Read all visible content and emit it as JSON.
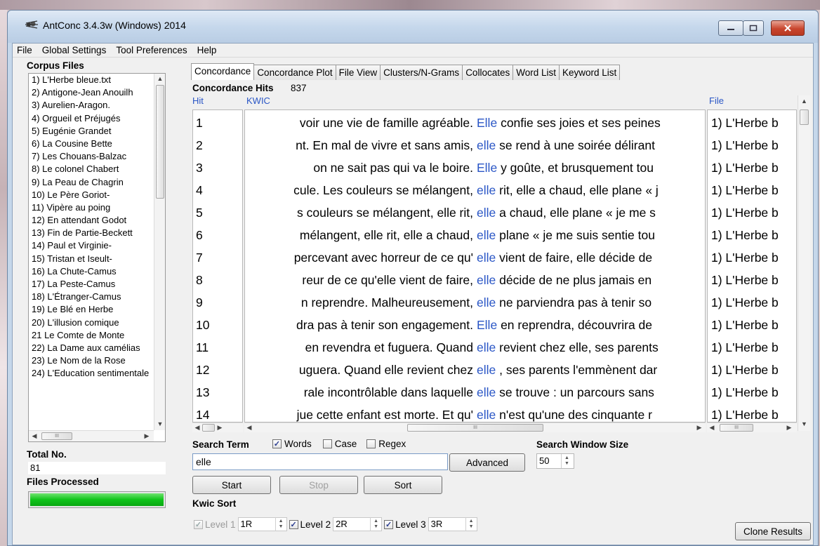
{
  "window": {
    "title": "AntConc 3.4.3w (Windows) 2014",
    "controls": {
      "minimize": "—",
      "maximize": "☐",
      "close": "✕"
    }
  },
  "menu": [
    "File",
    "Global Settings",
    "Tool Preferences",
    "Help"
  ],
  "left_panel": {
    "corpus_files_label": "Corpus Files",
    "corpus_files": [
      "1) L'Herbe bleue.txt",
      "2) Antigone-Jean Anouilh",
      "3) Aurelien-Aragon.",
      "4) Orgueil et Préjugés",
      "5) Eugénie Grandet",
      "6) La Cousine Bette",
      "7) Les Chouans-Balzac",
      "8) Le colonel Chabert",
      "9) La Peau de Chagrin",
      "10) Le Père Goriot-",
      "11) Vipère au poing",
      "12) En attendant Godot",
      "13) Fin de Partie-Beckett",
      "14) Paul et Virginie-",
      "15) Tristan et Iseult-",
      "16) La Chute-Camus",
      "17) La Peste-Camus",
      "18) L'Étranger-Camus",
      "19) Le Blé en Herbe",
      "20) L'illusion comique",
      "21 Le Comte de Monte",
      "22) La Dame aux camélias",
      "23) Le Nom de la Rose",
      "24) L'Education sentimentale"
    ],
    "total_no_label": "Total No.",
    "total_no_value": "81",
    "files_processed_label": "Files Processed",
    "files_processed_progress": 1.0
  },
  "tabs": [
    {
      "label": "Concordance",
      "active": true
    },
    {
      "label": "Concordance Plot",
      "active": false
    },
    {
      "label": "File View",
      "active": false
    },
    {
      "label": "Clusters/N-Grams",
      "active": false
    },
    {
      "label": "Collocates",
      "active": false
    },
    {
      "label": "Word List",
      "active": false
    },
    {
      "label": "Keyword List",
      "active": false
    }
  ],
  "concordance": {
    "hits_label": "Concordance Hits",
    "hits_value": "837",
    "col_hit": "Hit",
    "col_kwic": "KWIC",
    "col_file": "File",
    "rows": [
      {
        "hit": "1",
        "left": "voir une vie de famille agréable.",
        "kw": "Elle",
        "right": "confie ses joies et ses peines",
        "file": "1) L'Herbe b"
      },
      {
        "hit": "2",
        "left": "nt. En mal de vivre et sans amis,",
        "kw": "elle",
        "right": "se rend à une soirée délirant",
        "file": "1) L'Herbe b"
      },
      {
        "hit": "3",
        "left": "on ne sait pas qui va le boire.",
        "kw": "Elle",
        "right": "y goûte, et brusquement tou",
        "file": "1) L'Herbe b"
      },
      {
        "hit": "4",
        "left": "cule. Les couleurs se mélangent,",
        "kw": "elle",
        "right": "rit, elle a chaud, elle plane « j",
        "file": "1) L'Herbe b"
      },
      {
        "hit": "5",
        "left": "s couleurs se mélangent, elle rit,",
        "kw": "elle",
        "right": "a chaud, elle plane « je me s",
        "file": "1) L'Herbe b"
      },
      {
        "hit": "6",
        "left": "mélangent, elle rit, elle a chaud,",
        "kw": "elle",
        "right": "plane « je me suis sentie tou",
        "file": "1) L'Herbe b"
      },
      {
        "hit": "7",
        "left": "percevant avec horreur de ce qu'",
        "kw": "elle",
        "right": "vient de faire, elle décide de",
        "file": "1) L'Herbe b"
      },
      {
        "hit": "8",
        "left": "reur de ce qu'elle vient de faire,",
        "kw": "elle",
        "right": "décide de ne plus jamais en",
        "file": "1) L'Herbe b"
      },
      {
        "hit": "9",
        "left": "n reprendre. Malheureusement,",
        "kw": "elle",
        "right": "ne parviendra pas à tenir so",
        "file": "1) L'Herbe b"
      },
      {
        "hit": "10",
        "left": "dra pas à tenir son engagement.",
        "kw": "Elle",
        "right": "en reprendra, découvrira de",
        "file": "1) L'Herbe b"
      },
      {
        "hit": "11",
        "left": "en revendra et fuguera. Quand",
        "kw": "elle",
        "right": "revient chez elle, ses parents",
        "file": "1) L'Herbe b"
      },
      {
        "hit": "12",
        "left": "uguera. Quand elle revient chez",
        "kw": "elle",
        "right": ", ses parents l'emmènent dar",
        "file": "1) L'Herbe b"
      },
      {
        "hit": "13",
        "left": "rale incontrôlable dans laquelle",
        "kw": "elle",
        "right": "se trouve : un parcours sans",
        "file": "1) L'Herbe b"
      },
      {
        "hit": "14",
        "left": "jue cette enfant est morte. Et qu'",
        "kw": "elle",
        "right": "n'est qu'une des cinquante r",
        "file": "1) L'Herbe b"
      }
    ],
    "scroll_marker": "III"
  },
  "search": {
    "search_term_label": "Search Term",
    "words_label": "Words",
    "words_checked": true,
    "case_label": "Case",
    "case_checked": false,
    "regex_label": "Regex",
    "regex_checked": false,
    "value": "elle",
    "advanced_label": "Advanced",
    "window_size_label": "Search Window Size",
    "window_size_value": "50",
    "start_label": "Start",
    "stop_label": "Stop",
    "sort_label": "Sort"
  },
  "kwic_sort": {
    "label": "Kwic Sort",
    "level1_label": "Level 1",
    "level1_value": "1R",
    "level1_checked": true,
    "level2_label": "Level 2",
    "level2_value": "2R",
    "level2_checked": true,
    "level3_label": "Level 3",
    "level3_value": "3R",
    "level3_checked": true
  },
  "clone_results_label": "Clone Results",
  "icons": {
    "app": "antconc-icon",
    "check": "✓"
  },
  "colors": {
    "accent_blue": "#2a56c6",
    "progress_green": "#10c41a",
    "close_red": "#c9462e"
  }
}
